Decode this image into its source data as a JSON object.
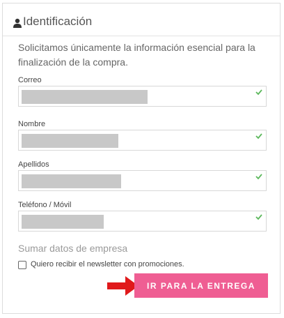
{
  "header": {
    "icon": "user-icon",
    "title": "Identificación"
  },
  "intro": "Solicitamos únicamente la información esencial para la finalización de la compra.",
  "fields": [
    {
      "label": "Correo",
      "redacted_value": true,
      "valid": true
    },
    {
      "label": "Nombre",
      "redacted_value": true,
      "valid": true
    },
    {
      "label": "Apellidos",
      "redacted_value": true,
      "valid": true
    },
    {
      "label": "Teléfono / Móvil",
      "redacted_value": true,
      "valid": true
    }
  ],
  "company_link": "Sumar datos de empresa",
  "newsletter": {
    "label": "Quiero recibir el newsletter con promociones.",
    "checked": false
  },
  "cta": {
    "label": "IR PARA LA ENTREGA"
  },
  "colors": {
    "accent": "#ef5e93",
    "check": "#5cb85c",
    "arrow": "#e0191b"
  }
}
